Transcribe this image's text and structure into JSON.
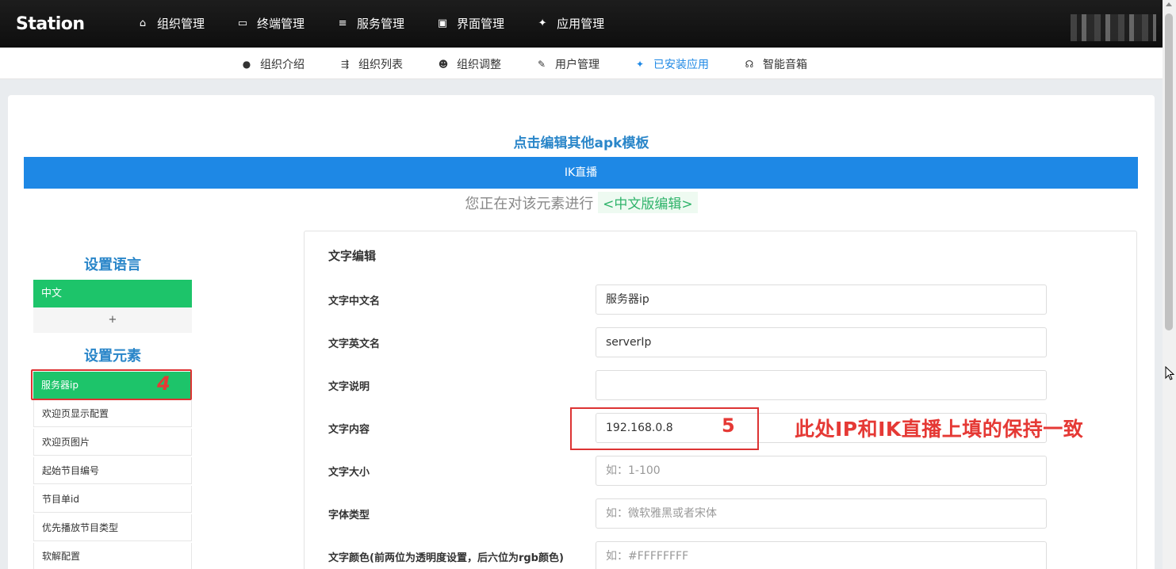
{
  "app": {
    "logo": "Station"
  },
  "topnav": [
    {
      "icon": "home-icon",
      "glyph": "⌂",
      "label": "组织管理"
    },
    {
      "icon": "terminal-icon",
      "glyph": "▭",
      "label": "终端管理"
    },
    {
      "icon": "server-icon",
      "glyph": "≡",
      "label": "服务管理"
    },
    {
      "icon": "display-icon",
      "glyph": "▣",
      "label": "界面管理"
    },
    {
      "icon": "android-icon",
      "glyph": "✦",
      "label": "应用管理"
    }
  ],
  "subnav": [
    {
      "icon": "info-icon",
      "glyph": "●",
      "label": "组织介绍",
      "active": false
    },
    {
      "icon": "list-icon",
      "glyph": "⇶",
      "label": "组织列表",
      "active": false
    },
    {
      "icon": "users-icon",
      "glyph": "☻",
      "label": "组织调整",
      "active": false
    },
    {
      "icon": "user-edit-icon",
      "glyph": "✎",
      "label": "用户管理",
      "active": false
    },
    {
      "icon": "android-icon",
      "glyph": "✦",
      "label": "已安装应用",
      "active": true
    },
    {
      "icon": "speaker-icon",
      "glyph": "☊",
      "label": "智能音箱",
      "active": false
    }
  ],
  "main": {
    "template_link": "点击编辑其他apk模板",
    "banner": "IK直播",
    "editing_prefix": "您正在对该元素进行",
    "editing_tag": "<中文版编辑>"
  },
  "left": {
    "lang_title": "设置语言",
    "lang_active": "中文",
    "lang_add": "+",
    "elem_title": "设置元素",
    "elements": [
      "服务器ip",
      "欢迎页显示配置",
      "欢迎页图片",
      "起始节目编号",
      "节目单id",
      "优先播放节目类型",
      "软解配置"
    ]
  },
  "form": {
    "title": "文字编辑",
    "rows": [
      {
        "label": "文字中文名",
        "value": "服务器ip",
        "placeholder": ""
      },
      {
        "label": "文字英文名",
        "value": "serverIp",
        "placeholder": ""
      },
      {
        "label": "文字说明",
        "value": "",
        "placeholder": ""
      },
      {
        "label": "文字内容",
        "value": "192.168.0.8",
        "placeholder": ""
      },
      {
        "label": "文字大小",
        "value": "",
        "placeholder": "如：1-100"
      },
      {
        "label": "字体类型",
        "value": "",
        "placeholder": "如：微软雅黑或者宋体"
      },
      {
        "label": "文字颜色(前两位为透明度设置，后六位为rgb颜色)",
        "value": "",
        "placeholder": "如：#FFFFFFFF"
      }
    ]
  },
  "annotations": {
    "step4": "4",
    "step5": "5",
    "note": "此处IP和IK直播上填的保持一致"
  },
  "colors": {
    "accent": "#1e88e5",
    "green": "#1dc46a",
    "annotation_red": "#e53935"
  }
}
